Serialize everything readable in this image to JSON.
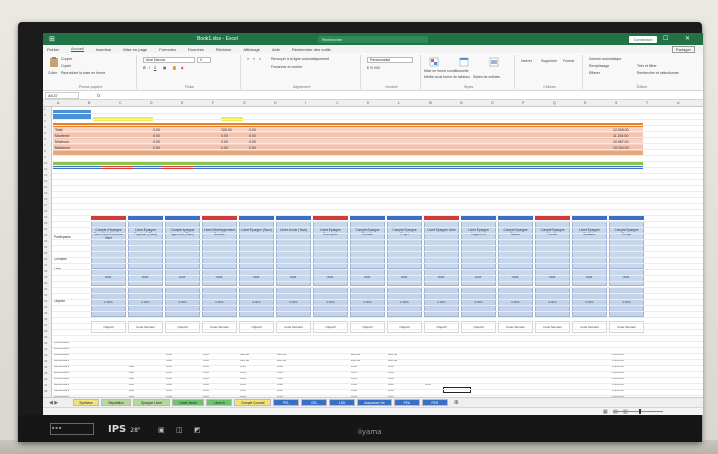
{
  "app": {
    "title": "Book1.xlsx - Excel",
    "search_placeholder": "Rechercher",
    "user_label": "Connexion",
    "share_label": "Partager",
    "brand": "iiyama",
    "panel_label": "IPS",
    "panel_size": "28\""
  },
  "tabs": [
    "Fichier",
    "Accueil",
    "Insertion",
    "Mise en page",
    "Formules",
    "Données",
    "Révision",
    "Affichage",
    "Aide",
    "Rechercher des outils"
  ],
  "ribbon": {
    "clipboard": {
      "paste": "Coller",
      "cut": "Couper",
      "copy": "Copier",
      "painter": "Reproduire la mise en forme",
      "label": "Presse-papiers"
    },
    "font": {
      "name": "Arial Narrow",
      "size": "9",
      "label": "Police"
    },
    "alignment": {
      "wrap": "Renvoyer à la ligne automatiquement",
      "merge": "Fusionner et centrer",
      "label": "Alignement"
    },
    "number": {
      "format": "Personnalisé",
      "label": "Nombre"
    },
    "styles": {
      "conditional": "Mise en forme conditionnelle",
      "table": "Mettre sous forme de tableau",
      "cell": "Styles de cellules",
      "label": "Styles"
    },
    "cells": {
      "insert": "Insérer",
      "delete": "Supprimer",
      "format": "Format",
      "label": "Cellules"
    },
    "editing": {
      "sum": "Somme automatique",
      "fill": "Remplissage",
      "clear": "Effacer",
      "sort": "Trier et filtrer",
      "find": "Rechercher et sélectionner",
      "label": "Édition"
    }
  },
  "formula_bar": {
    "name_box": "AK37",
    "fx": "fx"
  },
  "rows_left": {
    "r_a": "Participants",
    "r_b": "Comptes",
    "r_c": "Liste",
    "r_d": "Objectif"
  },
  "summary_rows": [
    {
      "label": "Total",
      "v1": "0.00",
      "v2": "100.00",
      "v3": "0.00",
      "vr": "12,345.00"
    },
    {
      "label": "Moyenne",
      "v1": "0.00",
      "v2": "0.00",
      "v3": "0.00",
      "vr": "11,234.00"
    },
    {
      "label": "Minimum",
      "v1": "0.00",
      "v2": "0.00",
      "v3": "0.00",
      "vr": "10,987.00"
    },
    {
      "label": "Maximum",
      "v1": "0.00",
      "v2": "0.00",
      "v3": "0.00",
      "vr": "19,234.00"
    }
  ],
  "headers": [
    "Compte d'épargne Taux d'intérêt annuel (fixe)",
    "Livret Épargne Populaire (Taux)",
    "Compte épargne logement (Taux)",
    "Livret Développement Durable",
    "Livret Épargne (Taux)",
    "Livret Jeune (Taux)",
    "Livret Épargne Entreprise",
    "Compte Épargne Retraite",
    "Compte Épargne Projet",
    "Livret Épargne Libre",
    "Livret Épargne Logement",
    "Compte Épargne Salaire",
    "Compte Épargne Famille",
    "Livret Épargne Solidaire",
    "Compte Épargne Temps"
  ],
  "mid_labels": [
    "Taux",
    "Taux",
    "Taux",
    "Taux",
    "Taux",
    "Taux",
    "Taux",
    "Taux",
    "Taux",
    "Taux",
    "Taux",
    "Taux",
    "Taux",
    "Taux",
    "Taux"
  ],
  "objectif_values": [
    "0.00%",
    "0.00%",
    "0.00%",
    "0.00%",
    "0.00%",
    "0.00%",
    "0.00%",
    "0.00%",
    "0.00%",
    "0.00%",
    "0.00%",
    "0.00%",
    "0.00%",
    "0.00%",
    "0.00%"
  ],
  "subheaders": [
    "Objectif",
    "Code Montant",
    "Objectif",
    "Code Montant",
    "Objectif",
    "Code Montant",
    "Objectif",
    "Objectif",
    "Objectif",
    "Objectif",
    "Objectif",
    "Code Montant",
    "Code Montant",
    "Code Montant",
    "Code Montant"
  ],
  "data_rows": [
    [
      "01/01/2021",
      "",
      "",
      "",
      "",
      "",
      "",
      "",
      "",
      "",
      "",
      "",
      "",
      "",
      "",
      ""
    ],
    [
      "02/01/2021",
      "",
      "",
      "",
      "",
      "",
      "",
      "",
      "",
      "",
      "",
      "",
      "",
      "",
      "",
      ""
    ],
    [
      "03/01/2021",
      "",
      "",
      "0.00",
      "0.00",
      "120.00",
      "200.00",
      "",
      "200.00",
      "200.00",
      "",
      "",
      "",
      "",
      "",
      "1,234.00"
    ],
    [
      "04/01/2021",
      "",
      "",
      "0.00",
      "0.00",
      "120.00",
      "200.00",
      "",
      "200.00",
      "200.00",
      "",
      "",
      "",
      "",
      "",
      "1,234.00"
    ],
    [
      "05/01/2021",
      "",
      "100",
      "0.00",
      "0.00",
      "0.00",
      "0.00",
      "",
      "0.00",
      "0.00",
      "",
      "",
      "",
      "",
      "",
      "1,234.00"
    ],
    [
      "06/01/2021",
      "",
      "100",
      "0.00",
      "0.00",
      "0.00",
      "0.00",
      "",
      "0.00",
      "0.00",
      "",
      "",
      "",
      "",
      "",
      "1,234.00"
    ],
    [
      "07/01/2021",
      "",
      "100",
      "0.00",
      "0.00",
      "0.00",
      "0.00",
      "",
      "0.00",
      "0.00",
      "",
      "",
      "",
      "",
      "",
      "1,234.00"
    ],
    [
      "08/01/2021",
      "",
      "100",
      "0.00",
      "0.00",
      "0.00",
      "0.00",
      "",
      "0.00",
      "0.00",
      "0.00",
      "",
      "",
      "",
      "",
      "1,234.00"
    ],
    [
      "09/01/2021",
      "",
      "100",
      "0.00",
      "0.00",
      "0.00",
      "0.00",
      "",
      "0.00",
      "0.00",
      "",
      "",
      "",
      "",
      "",
      "1,234.00"
    ],
    [
      "10/01/2021",
      "",
      "100",
      "0.00",
      "0.00",
      "0.00",
      "0.00",
      "",
      "0.00",
      "0.00",
      "",
      "",
      "",
      "",
      "",
      "1,234.00"
    ],
    [
      "11/01/2021",
      "",
      "100",
      "0.00",
      "0.00",
      "0.00",
      "0.00",
      "",
      "0.00",
      "0.00",
      "",
      "",
      "",
      "",
      "",
      "1,234.00"
    ]
  ],
  "sheet_tabs": [
    {
      "label": "Synthèse",
      "color": "#f2e27a"
    },
    {
      "label": "Répartition",
      "color": "#b5d99c"
    },
    {
      "label": "Épargne Livret",
      "color": "#b5d99c"
    },
    {
      "label": "Livret Jeune",
      "color": "#6fc06f"
    },
    {
      "label": "Livret A",
      "color": "#6fc06f"
    },
    {
      "label": "Compte Courant",
      "color": "#f2e27a"
    },
    {
      "label": "PEL",
      "color": "#3a6fc4"
    },
    {
      "label": "CEL",
      "color": "#3a6fc4"
    },
    {
      "label": "LDD",
      "color": "#3a6fc4"
    },
    {
      "label": "Assurance Vie",
      "color": "#3a6fc4"
    },
    {
      "label": "PEA",
      "color": "#3a6fc4"
    },
    {
      "label": "PER",
      "color": "#3a6fc4"
    }
  ],
  "colors": {
    "excel_green": "#217346",
    "orange_bar": "#e8822b",
    "yellow_cell": "#f3ea59",
    "blue_cell": "#4a90d9",
    "header_blue": "#c9d7ea"
  }
}
